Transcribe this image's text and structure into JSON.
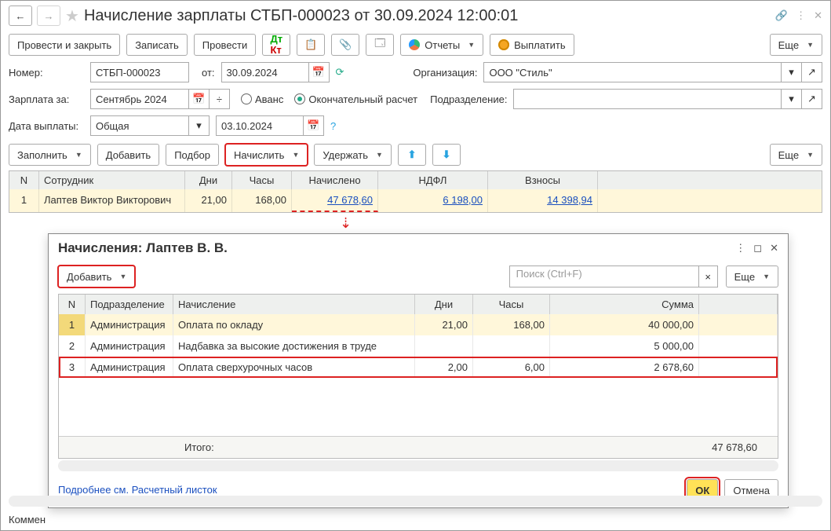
{
  "header": {
    "title": "Начисление зарплаты СТБП-000023 от 30.09.2024 12:00:01"
  },
  "toolbar": {
    "post_close": "Провести и закрыть",
    "write": "Записать",
    "post": "Провести",
    "reports": "Отчеты",
    "pay": "Выплатить",
    "more": "Еще"
  },
  "fields": {
    "number_lbl": "Номер:",
    "number": "СТБП-000023",
    "from_lbl": "от:",
    "date": "30.09.2024",
    "org_lbl": "Организация:",
    "org": "ООО \"Стиль\"",
    "salary_for_lbl": "Зарплата за:",
    "period": "Сентябрь 2024",
    "advance": "Аванс",
    "final": "Окончательный расчет",
    "dept_lbl": "Подразделение:",
    "pay_date_lbl": "Дата выплаты:",
    "pay_date_type": "Общая",
    "pay_date": "03.10.2024"
  },
  "table_toolbar": {
    "fill": "Заполнить",
    "add": "Добавить",
    "pick": "Подбор",
    "accrue": "Начислить",
    "withhold": "Удержать",
    "more": "Еще"
  },
  "main_table": {
    "headers": {
      "n": "N",
      "emp": "Сотрудник",
      "days": "Дни",
      "hours": "Часы",
      "accrued": "Начислено",
      "ndfl": "НДФЛ",
      "contrib": "Взносы"
    },
    "row": {
      "n": "1",
      "emp": "Лаптев Виктор Викторович",
      "days": "21,00",
      "hours": "168,00",
      "accrued": "47 678,60",
      "ndfl": "6 198,00",
      "contrib": "14 398,94"
    }
  },
  "dialog": {
    "title": "Начисления: Лаптев В. В.",
    "add": "Добавить",
    "search_placeholder": "Поиск (Ctrl+F)",
    "more": "Еще",
    "headers": {
      "n": "N",
      "dep": "Подразделение",
      "accr": "Начисление",
      "days": "Дни",
      "hours": "Часы",
      "sum": "Сумма"
    },
    "rows": [
      {
        "n": "1",
        "dep": "Администрация",
        "accr": "Оплата по окладу",
        "days": "21,00",
        "hours": "168,00",
        "sum": "40 000,00"
      },
      {
        "n": "2",
        "dep": "Администрация",
        "accr": "Надбавка за высокие достижения в труде",
        "days": "",
        "hours": "",
        "sum": "5 000,00"
      },
      {
        "n": "3",
        "dep": "Администрация",
        "accr": "Оплата сверхурочных часов",
        "days": "2,00",
        "hours": "6,00",
        "sum": "2 678,60"
      }
    ],
    "total_lbl": "Итого:",
    "total": "47 678,60",
    "payslip_link": "Подробнее см. Расчетный листок",
    "ok": "ОК",
    "cancel": "Отмена"
  },
  "bottom": {
    "comment_lbl": "Коммен"
  }
}
